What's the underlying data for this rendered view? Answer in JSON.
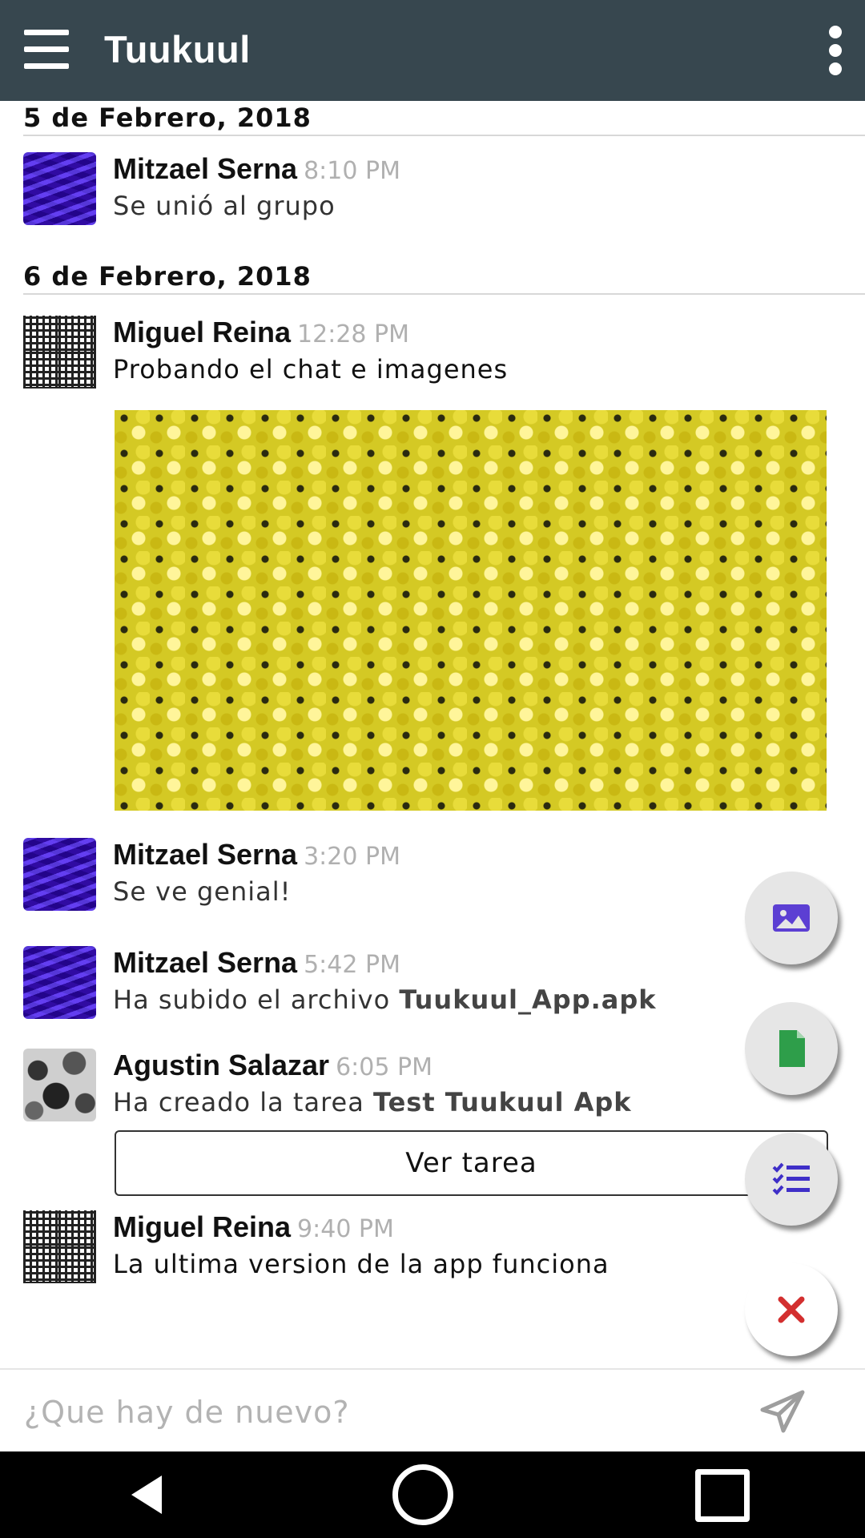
{
  "app": {
    "title": "Tuukuul",
    "colors": {
      "appbar": "#37474f",
      "accent": "#5c3fd3",
      "file": "#2e9e4a",
      "close": "#d32f2f"
    }
  },
  "dates": [
    "5 de Febrero, 2018",
    "6 de Febrero, 2018"
  ],
  "messages": [
    {
      "name": "Mitzael Serna",
      "time": "8:10 PM",
      "text": "Se unió al grupo",
      "avatar": "blue-wave-avatar"
    },
    {
      "name": "Miguel Reina",
      "time": "12:28 PM",
      "text": "Probando el chat e imagenes",
      "avatar": "maze-avatar",
      "attachment": "yellow-flowers-image"
    },
    {
      "name": "Mitzael Serna",
      "time": "3:20 PM",
      "text": "Se ve genial!",
      "avatar": "blue-wave-avatar"
    },
    {
      "name": "Mitzael Serna",
      "time": "5:42 PM",
      "text_prefix": "Ha subido el archivo ",
      "text_bold": "Tuukuul_App.apk",
      "avatar": "blue-wave-avatar"
    },
    {
      "name": "Agustin Salazar",
      "time": "6:05 PM",
      "text_prefix": "Ha creado la tarea ",
      "text_bold": "Test Tuukuul Apk",
      "avatar": "camo-avatar",
      "action_label": "Ver tarea"
    },
    {
      "name": "Miguel Reina",
      "time": "9:40 PM",
      "text": "La ultima version de la app funciona",
      "avatar": "maze-avatar"
    }
  ],
  "fab_actions": [
    {
      "icon": "image-icon"
    },
    {
      "icon": "file-icon"
    },
    {
      "icon": "task-list-icon"
    },
    {
      "icon": "close-icon"
    }
  ],
  "composer": {
    "placeholder": "¿Que hay de nuevo?",
    "send_icon": "send-icon"
  },
  "navbar": {
    "icons": [
      "back-icon",
      "home-icon",
      "recents-icon"
    ]
  }
}
